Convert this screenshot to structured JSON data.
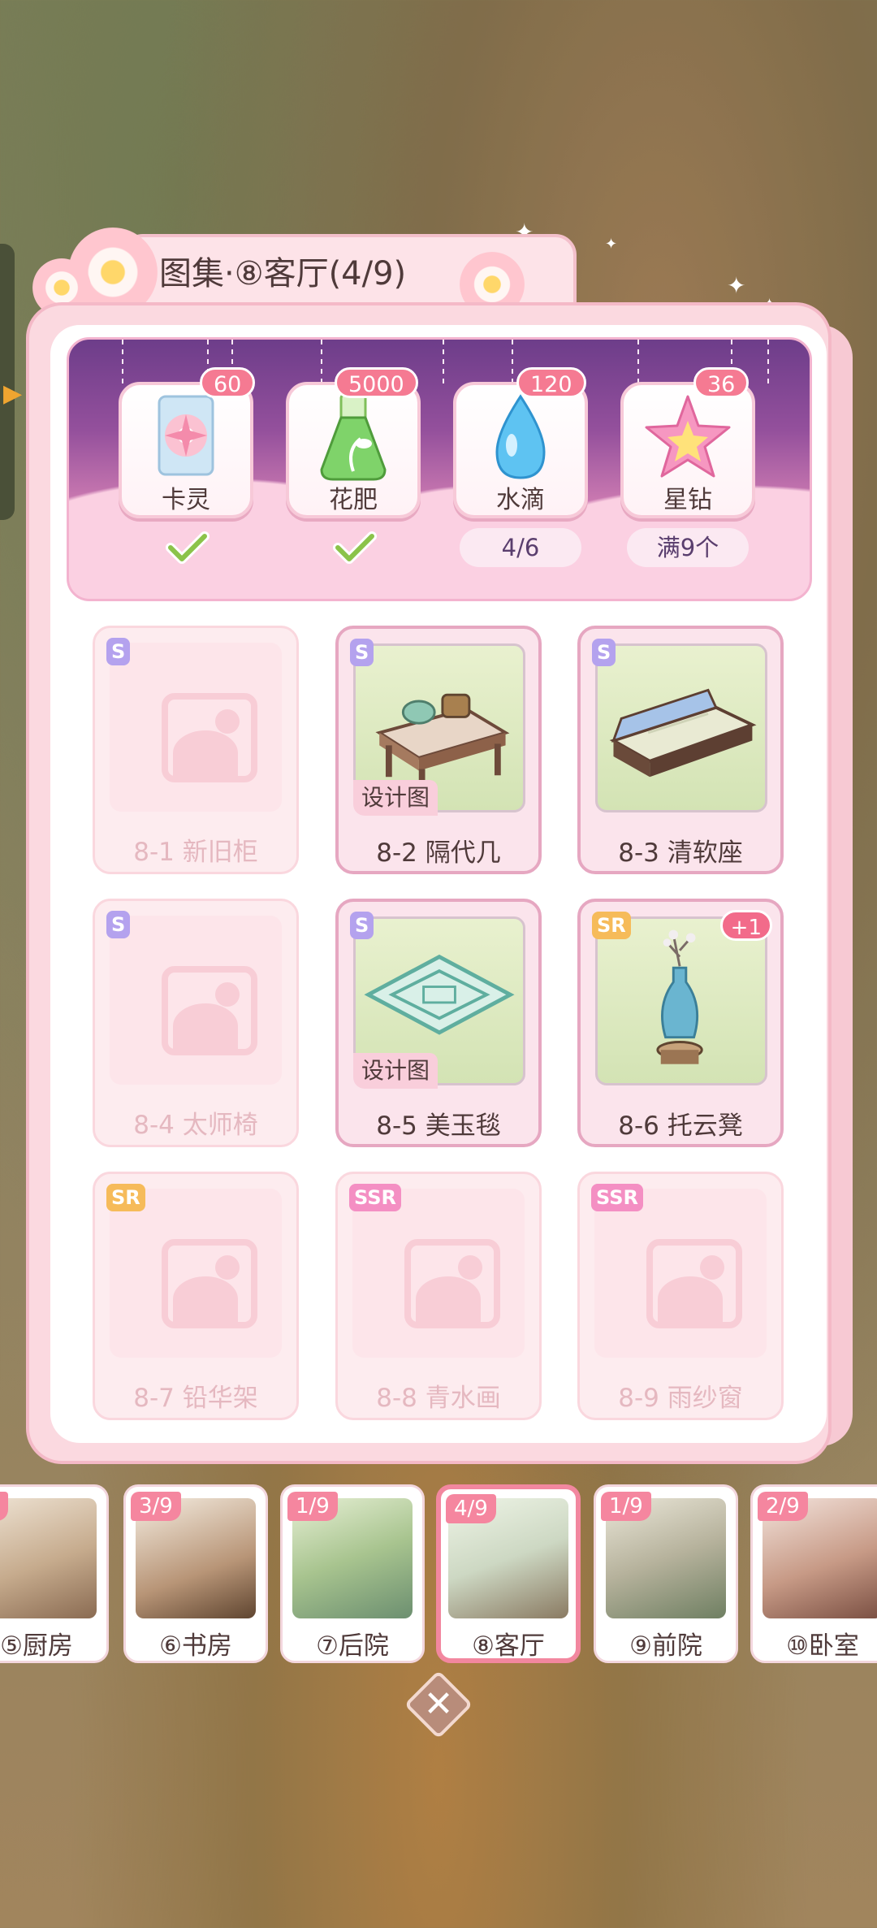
{
  "title": "图集·⑧客厅(4/9)",
  "rewards": [
    {
      "name": "卡灵",
      "count": "60",
      "icon": "card-spirit-icon",
      "status": "claimed"
    },
    {
      "name": "花肥",
      "count": "5000",
      "icon": "fertilizer-flask-icon",
      "status": "claimed"
    },
    {
      "name": "水滴",
      "count": "120",
      "icon": "water-drop-icon",
      "status": "progress",
      "progress": "4/6"
    },
    {
      "name": "星钻",
      "count": "36",
      "icon": "star-diamond-icon",
      "status": "progress",
      "progress": "满9个"
    }
  ],
  "items": [
    {
      "label": "8-1 新旧柜",
      "rarity": "S",
      "owned": false
    },
    {
      "label": "8-2 隔代几",
      "rarity": "S",
      "owned": true,
      "tag": "设计图",
      "icon": "tea-table-icon"
    },
    {
      "label": "8-3 清软座",
      "rarity": "S",
      "owned": true,
      "icon": "sofa-icon"
    },
    {
      "label": "8-4 太师椅",
      "rarity": "S",
      "owned": false
    },
    {
      "label": "8-5 美玉毯",
      "rarity": "S",
      "owned": true,
      "tag": "设计图",
      "icon": "jade-rug-icon"
    },
    {
      "label": "8-6 托云凳",
      "rarity": "SR",
      "owned": true,
      "extra": "+1",
      "icon": "vase-icon"
    },
    {
      "label": "8-7 铅华架",
      "rarity": "SR",
      "owned": false
    },
    {
      "label": "8-8 青水画",
      "rarity": "SSR",
      "owned": false
    },
    {
      "label": "8-9 雨纱窗",
      "rarity": "SSR",
      "owned": false
    }
  ],
  "rooms": [
    {
      "label": "⑤厨房",
      "count": "/9"
    },
    {
      "label": "⑥书房",
      "count": "3/9"
    },
    {
      "label": "⑦后院",
      "count": "1/9"
    },
    {
      "label": "⑧客厅",
      "count": "4/9",
      "selected": true
    },
    {
      "label": "⑨前院",
      "count": "1/9"
    },
    {
      "label": "⑩卧室",
      "count": "2/9"
    }
  ],
  "close_label": "✕",
  "colors": {
    "accent_pink": "#f57a92",
    "rarity_s": "#b4a2ee",
    "rarity_sr": "#f6bb5a",
    "rarity_ssr": "#f48fc3"
  }
}
